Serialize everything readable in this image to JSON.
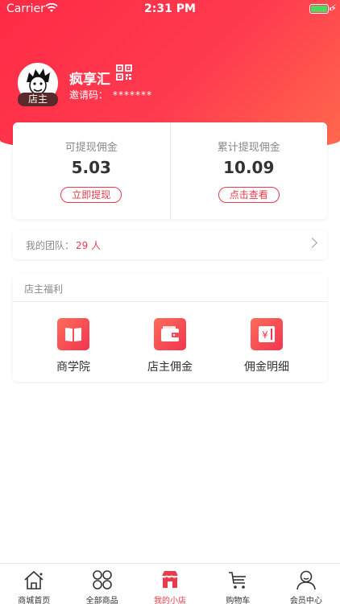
{
  "status_bar": {
    "carrier": "Carrier",
    "time": "2:31 PM"
  },
  "profile": {
    "username": "疯享汇",
    "role_badge": "店主",
    "invite_label": "邀请码：",
    "invite_code": "*******"
  },
  "commission": {
    "withdrawable": {
      "label": "可提现佣金",
      "value": "5.03",
      "button": "立即提现"
    },
    "total_withdrawn": {
      "label": "累计提现佣金",
      "value": "10.09",
      "button": "点击查看"
    }
  },
  "team": {
    "label": "我的团队：",
    "count": "29 人"
  },
  "welfare": {
    "title": "店主福利",
    "items": [
      {
        "label": "商学院",
        "icon": "book-icon"
      },
      {
        "label": "店主佣金",
        "icon": "wallet-icon"
      },
      {
        "label": "佣金明细",
        "icon": "yen-receipt-icon"
      }
    ]
  },
  "tabs": [
    {
      "label": "商城首页",
      "icon": "home-icon"
    },
    {
      "label": "全部商品",
      "icon": "grid-icon"
    },
    {
      "label": "我的小店",
      "icon": "shop-icon",
      "active": true
    },
    {
      "label": "购物车",
      "icon": "cart-icon"
    },
    {
      "label": "会员中心",
      "icon": "user-icon"
    }
  ],
  "colors": {
    "accent": "#e63c4b",
    "header_start": "#ff2a45",
    "header_end": "#ff6a4d"
  }
}
